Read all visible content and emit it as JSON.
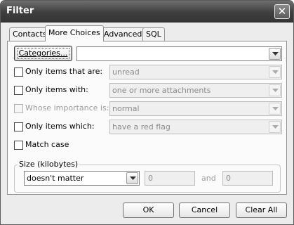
{
  "window": {
    "title": "Filter"
  },
  "tabs": [
    {
      "label": "Contacts"
    },
    {
      "label": "More Choices"
    },
    {
      "label": "Advanced"
    },
    {
      "label": "SQL"
    }
  ],
  "categories": {
    "button_label": "Categories...",
    "value": ""
  },
  "rows": [
    {
      "label": "Only items that are:",
      "value": "unread",
      "enabled": true,
      "checked": false
    },
    {
      "label": "Only items with:",
      "value": "one or more attachments",
      "enabled": true,
      "checked": false
    },
    {
      "label": "Whose importance is:",
      "value": "normal",
      "enabled": false,
      "checked": false
    },
    {
      "label": "Only items which:",
      "value": "have a red flag",
      "enabled": true,
      "checked": false
    }
  ],
  "match_case": {
    "label": "Match case",
    "checked": false
  },
  "size": {
    "legend": "Size (kilobytes)",
    "condition": "doesn't matter",
    "min": "0",
    "and_label": "and",
    "max": "0"
  },
  "buttons": {
    "ok": "OK",
    "cancel": "Cancel",
    "clear_all": "Clear All"
  },
  "icons": {
    "close": "close-icon",
    "dropdown": "chevron-down-icon"
  }
}
